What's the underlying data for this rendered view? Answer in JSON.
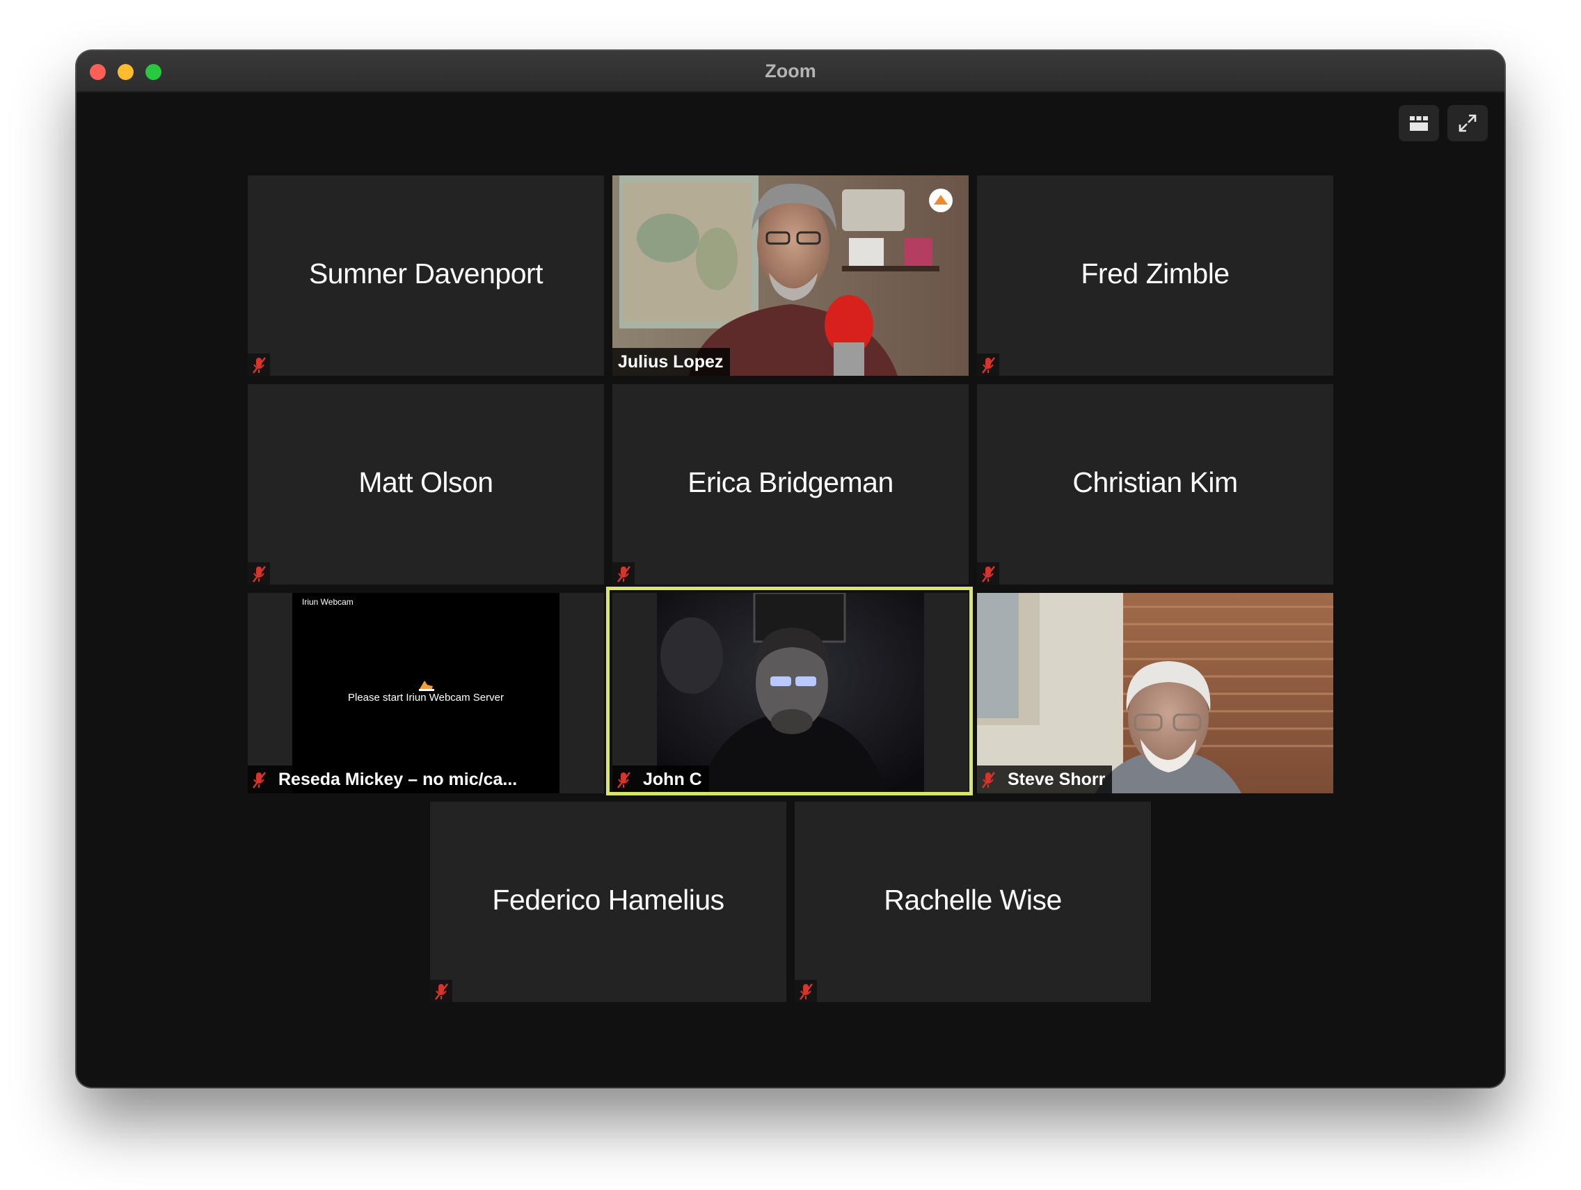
{
  "window": {
    "title": "Zoom"
  },
  "controls": {
    "gallery_view_icon": "grid-icon",
    "fullscreen_icon": "expand-icon"
  },
  "colors": {
    "active_speaker_border": "#d8e66e",
    "muted_icon": "#d9342b",
    "tile_bg": "#232323"
  },
  "participants": [
    {
      "name": "Sumner Davenport",
      "video": false,
      "muted": true
    },
    {
      "name": "Julius Lopez",
      "video": true,
      "muted": false
    },
    {
      "name": "Fred Zimble",
      "video": false,
      "muted": true
    },
    {
      "name": "Matt Olson",
      "video": false,
      "muted": true
    },
    {
      "name": "Erica Bridgeman",
      "video": false,
      "muted": true
    },
    {
      "name": "Christian Kim",
      "video": false,
      "muted": true
    },
    {
      "name": "Reseda Mickey – no mic/ca...",
      "video": true,
      "muted": true,
      "screen_title": "Iriun Webcam",
      "screen_message": "Please start Iriun Webcam Server"
    },
    {
      "name": "John C",
      "video": true,
      "muted": true,
      "active_speaker": true
    },
    {
      "name": "Steve Shorr",
      "video": true,
      "muted": true
    },
    {
      "name": "Federico Hamelius",
      "video": false,
      "muted": true
    },
    {
      "name": "Rachelle Wise",
      "video": false,
      "muted": true
    }
  ]
}
